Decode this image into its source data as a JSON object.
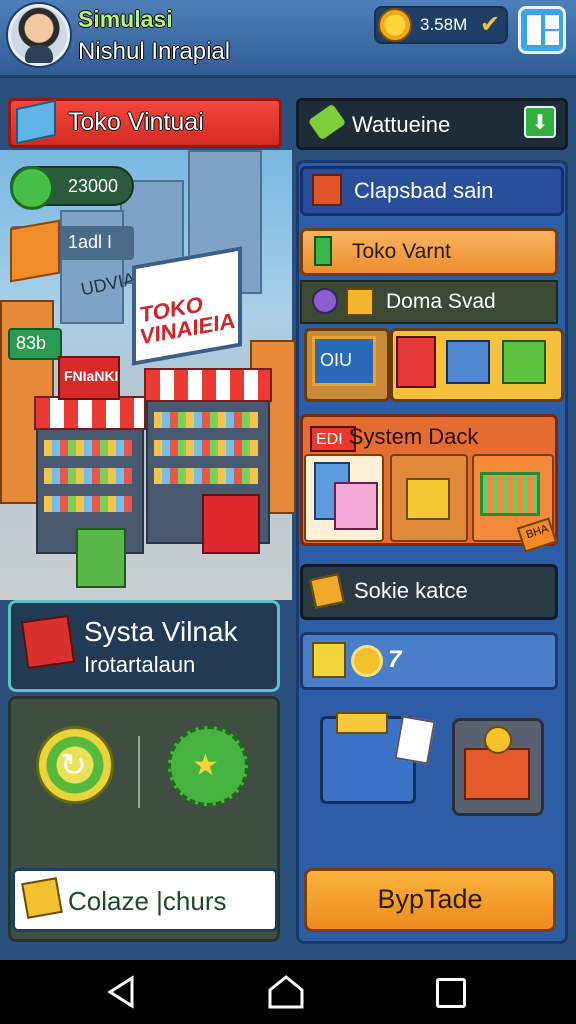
{
  "header": {
    "title": "Simulasi",
    "subtitle": "Nishul Inrapial",
    "coins": "3.58M",
    "colors": {
      "bar": "#3a6aa8",
      "title": "#bff07a"
    }
  },
  "left": {
    "shop_banner": "Toko Vintuai",
    "stats": [
      "23000",
      "1adl I",
      "83b"
    ],
    "scene_sign_small": "UDVIA SRIUL",
    "scene_sign_big": "TOKO VINAIEIA",
    "scene_sign_red": "FNIaNKI",
    "info_title": "Systa Vilnak",
    "info_subtitle": "Irotartalaun",
    "collect_label": "Colaze |churs"
  },
  "right": {
    "warehouse": "Wattueine",
    "capacity": "Clapsbad sain",
    "shop_item": "Toko Varnt",
    "domain": "Doma Svad",
    "slot_label": "OIU",
    "system": "System Dack",
    "system_badge": "EDI",
    "system_tag": "BHA",
    "stock": "Sokie katce",
    "task_count": "7",
    "trade_label": "BypTade"
  },
  "icons": [
    "avatar",
    "coin-icon",
    "check-icon",
    "menu-grid-icon",
    "box-icon",
    "shield-icon",
    "crate-icon",
    "refresh-icon",
    "reward-badge-icon",
    "gift-icon",
    "pencil-icon",
    "download-icon",
    "cash-register-icon",
    "shopping-cart-icon",
    "printer-icon",
    "gear-icon",
    "back-icon",
    "home-icon",
    "recent-apps-icon"
  ]
}
